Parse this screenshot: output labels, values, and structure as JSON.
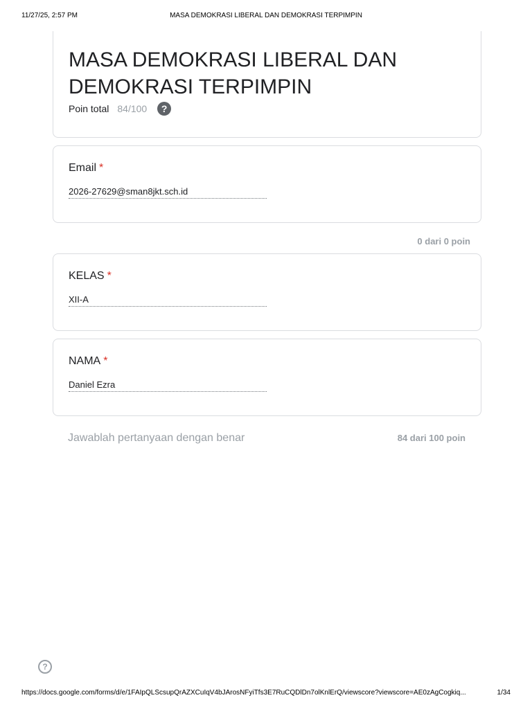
{
  "print_header": {
    "datetime": "11/27/25, 2:57 PM",
    "document_title": "MASA DEMOKRASI LIBERAL DAN DEMOKRASI TERPIMPIN"
  },
  "form": {
    "title": "MASA DEMOKRASI LIBERAL DAN DEMOKRASI TERPIMPIN",
    "total_label": "Poin total",
    "total_score": "84/100",
    "help_icon_glyph": "?"
  },
  "questions": {
    "email": {
      "label": "Email",
      "required_mark": "*",
      "answer": "2026-27629@sman8jkt.sch.id"
    },
    "kelas": {
      "label": "KELAS",
      "required_mark": "*",
      "answer": "XII-A"
    },
    "nama": {
      "label": "NAMA",
      "required_mark": "*",
      "answer": "Daniel Ezra"
    }
  },
  "section_scores": {
    "identity": "0 dari 0 poin",
    "main_description": "Jawablah pertanyaan dengan benar",
    "main": "84 dari 100 poin"
  },
  "footer_help_glyph": "?",
  "print_footer": {
    "url": "https://docs.google.com/forms/d/e/1FAIpQLScsupQrAZXCuIqV4bJArosNFyiTfs3E7RuCQDlDn7olKnlErQ/viewscore?viewscore=AE0zAgCogkiq...",
    "page": "1/34"
  },
  "colors": {
    "required": "#d93025",
    "muted": "#9aa0a6",
    "border": "#dadce0"
  }
}
